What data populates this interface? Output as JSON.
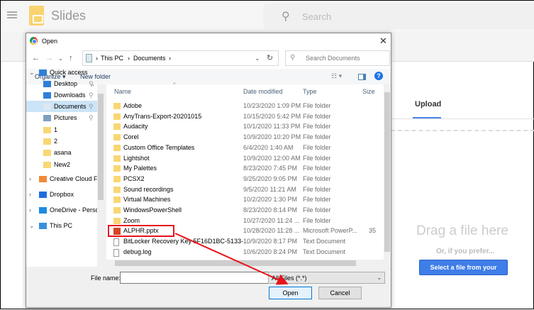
{
  "app": {
    "title": "Slides",
    "search_placeholder": "Search"
  },
  "picker": {
    "tab": "Upload",
    "drag_text": "Drag a file here",
    "prefer_text": "Or, if you prefer...",
    "select_button": "Select a file from your device",
    "accent": "#3f7de8"
  },
  "dialog": {
    "title": "Open",
    "breadcrumb": [
      "This PC",
      "Documents"
    ],
    "search_placeholder": "Search Documents",
    "toolbar": {
      "organize": "Organize ▾",
      "new_folder": "New folder"
    },
    "nav": [
      {
        "label": "Quick access",
        "icon": "star-icon"
      },
      {
        "label": "Desktop",
        "icon": "desktop-icon"
      },
      {
        "label": "Downloads",
        "icon": "download-icon"
      },
      {
        "label": "Documents",
        "icon": "document-icon",
        "selected": true
      },
      {
        "label": "Pictures",
        "icon": "picture-icon"
      },
      {
        "label": "1",
        "icon": "folder-icon"
      },
      {
        "label": "2",
        "icon": "folder-icon"
      },
      {
        "label": "asana",
        "icon": "folder-icon"
      },
      {
        "label": "New2",
        "icon": "folder-icon"
      },
      {
        "label": "Creative Cloud Fil",
        "icon": "creative-cloud-icon"
      },
      {
        "label": "Dropbox",
        "icon": "dropbox-icon"
      },
      {
        "label": "OneDrive - Persor",
        "icon": "onedrive-icon"
      },
      {
        "label": "This PC",
        "icon": "pc-icon"
      }
    ],
    "columns": {
      "name": "Name",
      "date": "Date modified",
      "type": "Type",
      "size": "Size"
    },
    "files": [
      {
        "name": "Adobe",
        "date": "10/23/2020 1:09 PM",
        "type": "File folder",
        "size": "",
        "kind": "folder"
      },
      {
        "name": "AnyTrans-Export-20201015",
        "date": "10/15/2020 5:42 PM",
        "type": "File folder",
        "size": "",
        "kind": "folder"
      },
      {
        "name": "Audacity",
        "date": "10/1/2020 11:33 PM",
        "type": "File folder",
        "size": "",
        "kind": "folder"
      },
      {
        "name": "Corel",
        "date": "10/9/2020 10:20 PM",
        "type": "File folder",
        "size": "",
        "kind": "folder"
      },
      {
        "name": "Custom Office Templates",
        "date": "6/4/2020 1:40 AM",
        "type": "File folder",
        "size": "",
        "kind": "folder"
      },
      {
        "name": "Lightshot",
        "date": "10/9/2020 12:00 AM",
        "type": "File folder",
        "size": "",
        "kind": "folder"
      },
      {
        "name": "My Palettes",
        "date": "8/23/2020 7:45 PM",
        "type": "File folder",
        "size": "",
        "kind": "folder"
      },
      {
        "name": "PCSX2",
        "date": "9/25/2020 9:05 PM",
        "type": "File folder",
        "size": "",
        "kind": "folder"
      },
      {
        "name": "Sound recordings",
        "date": "9/5/2020 11:21 AM",
        "type": "File folder",
        "size": "",
        "kind": "folder"
      },
      {
        "name": "Virtual Machines",
        "date": "10/2/2020 1:30 PM",
        "type": "File folder",
        "size": "",
        "kind": "folder"
      },
      {
        "name": "WindowsPowerShell",
        "date": "8/23/2020 8:14 PM",
        "type": "File folder",
        "size": "",
        "kind": "folder"
      },
      {
        "name": "Zoom",
        "date": "10/27/2020 11:24 ...",
        "type": "File folder",
        "size": "",
        "kind": "folder"
      },
      {
        "name": "ALPHR.pptx",
        "date": "10/28/2020 11:28 ...",
        "type": "Microsoft PowerP...",
        "size": "35",
        "kind": "pptx"
      },
      {
        "name": "BitLocker Recovery Key 5F16D1BC-5133-...",
        "date": "10/9/2020 8:17 PM",
        "type": "Text Document",
        "size": "",
        "kind": "text"
      },
      {
        "name": "debug.log",
        "date": "10/6/2020 8:24 PM",
        "type": "Text Document",
        "size": "",
        "kind": "text"
      }
    ],
    "file_name_label": "File name:",
    "file_name_value": "",
    "filter": "All Files (*.*)",
    "open": "Open",
    "cancel": "Cancel",
    "annotation_color": "#e8141c"
  }
}
